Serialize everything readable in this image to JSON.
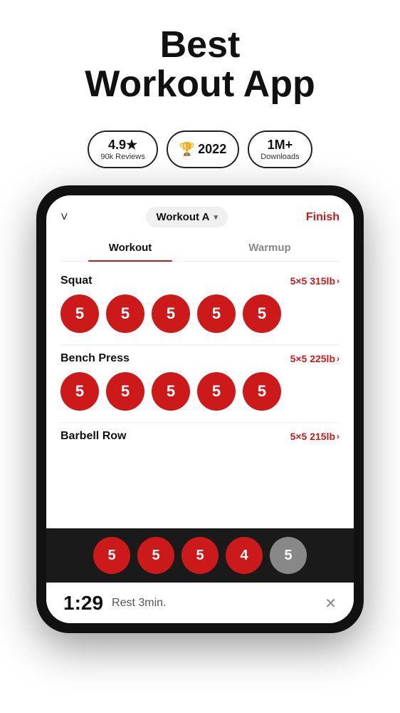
{
  "header": {
    "title": "Best",
    "title2": "Workout App"
  },
  "badges": [
    {
      "main": "4.9★",
      "sub": "90k Reviews",
      "icon": "star-icon"
    },
    {
      "main": "2022",
      "sub": "",
      "icon": "trophy-icon",
      "prefix": "🏆"
    },
    {
      "main": "1M+",
      "sub": "Downloads",
      "icon": "download-icon"
    }
  ],
  "app": {
    "workout_selector": "Workout A",
    "finish_label": "Finish",
    "tabs": [
      {
        "label": "Workout",
        "active": true
      },
      {
        "label": "Warmup",
        "active": false
      }
    ],
    "exercises": [
      {
        "name": "Squat",
        "detail": "5×5 315lb",
        "sets": [
          5,
          5,
          5,
          5,
          5
        ],
        "dim": []
      },
      {
        "name": "Bench Press",
        "detail": "5×5 225lb",
        "sets": [
          5,
          5,
          5,
          5,
          5
        ],
        "dim": []
      },
      {
        "name": "Barbell Row",
        "detail": "5×5 215lb",
        "sets": [],
        "dim": []
      }
    ],
    "bottom_sets": [
      5,
      5,
      5,
      4,
      5
    ],
    "bottom_dim": [
      4
    ],
    "timer": {
      "time": "1:29",
      "label": "Rest 3min."
    }
  }
}
